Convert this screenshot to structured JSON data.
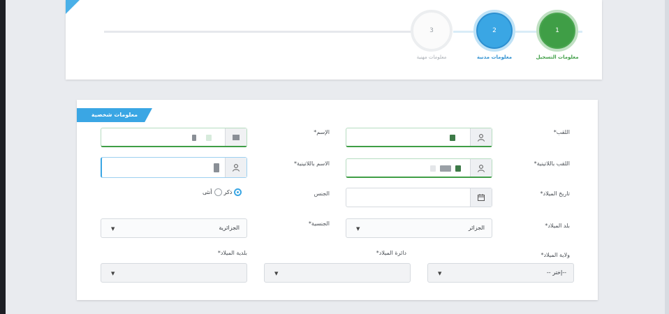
{
  "stepper": {
    "steps": [
      {
        "number": "1",
        "label": "معلومات التسجيل",
        "state": "done",
        "color": "#3f9e46"
      },
      {
        "number": "2",
        "label": "معلومات مدنية",
        "state": "active",
        "color": "#3aa6e4"
      },
      {
        "number": "3",
        "label": "معلومات مهنية",
        "state": "pending",
        "color": "#9aa0a6"
      }
    ]
  },
  "form": {
    "section_title": "معلومات شخصية",
    "labels": {
      "last_name": "اللقب*",
      "first_name": "الإسم*",
      "last_name_latin": "اللقب باللاتينية*",
      "first_name_latin": "الاسم باللاتينية*",
      "birth_date": "تاريخ الميلاد*",
      "gender": "الجنس",
      "birth_country": "بلد الميلاد*",
      "nationality": "الجنسية*",
      "birth_wilaya": "ولاية الميلاد*",
      "birth_daira": "دائرة الميلاد*",
      "birth_commune": "بلدية الميلاد*"
    },
    "gender_options": {
      "male": "ذكر",
      "female": "أنثى",
      "selected": "male"
    },
    "birth_country_value": "الجزائر",
    "nationality_value": "الجزائرية",
    "birth_wilaya_value": "--إختر --",
    "birth_daira_value": "",
    "birth_commune_value": ""
  },
  "colors": {
    "accent": "#3aa6e4",
    "success": "#3f9e46"
  }
}
